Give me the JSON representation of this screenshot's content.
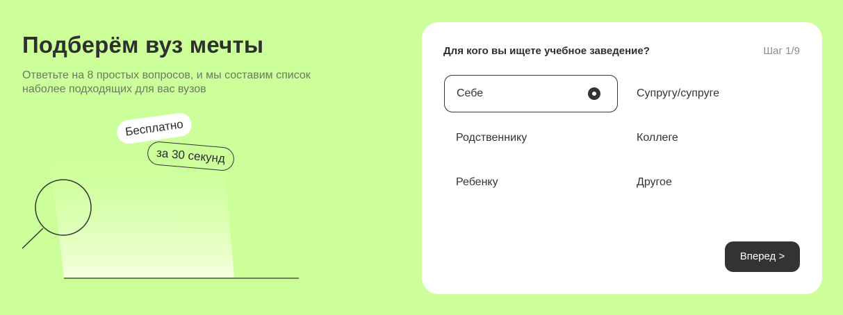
{
  "hero": {
    "title": "Подберём вуз мечты",
    "subtitle": "Ответьте на 8 простых вопросов, и мы составим список наболее подходящих для вас вузов",
    "badge_free": "Бесплатно",
    "badge_time": "за 30 секунд"
  },
  "quiz": {
    "question": "Для кого вы ищете учебное заведение?",
    "step": "Шаг 1/9",
    "options": [
      {
        "label": "Себе",
        "selected": true
      },
      {
        "label": "Супругу/супруге",
        "selected": false
      },
      {
        "label": "Родственнику",
        "selected": false
      },
      {
        "label": "Коллеге",
        "selected": false
      },
      {
        "label": "Ребенку",
        "selected": false
      },
      {
        "label": "Другое",
        "selected": false
      }
    ],
    "next_label": "Вперед >"
  },
  "colors": {
    "background": "#ccff99",
    "card": "#ffffff",
    "button": "#333333"
  }
}
